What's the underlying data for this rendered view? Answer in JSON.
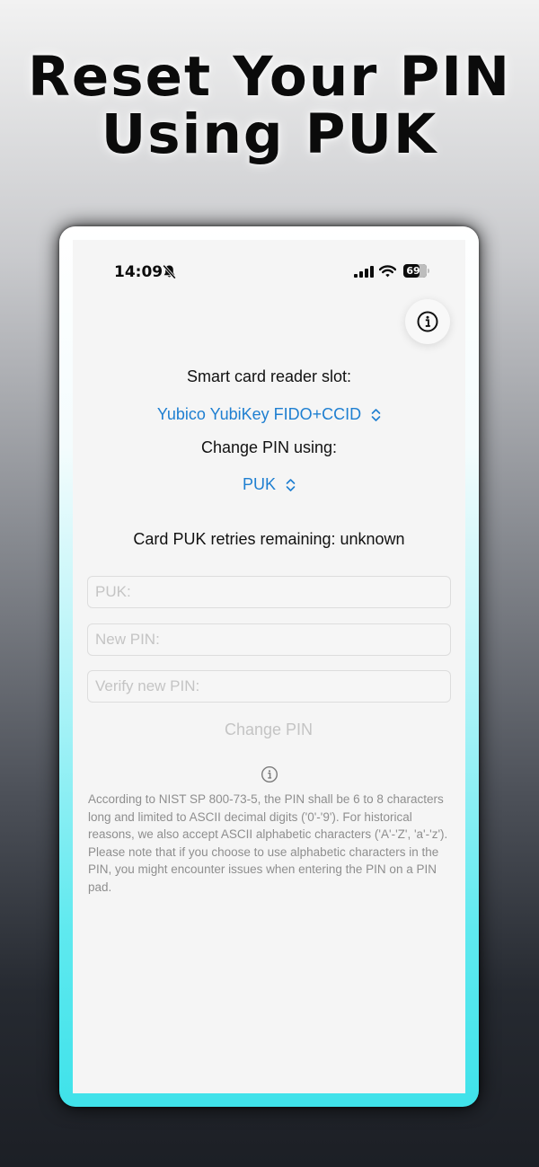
{
  "headline": {
    "line1": "Reset Your PIN",
    "line2": "Using PUK"
  },
  "status_bar": {
    "time": "14:09",
    "battery": "69",
    "icons": [
      "bell-slash-icon",
      "cellular-signal-icon",
      "wifi-icon",
      "battery-icon"
    ]
  },
  "info_button": {
    "icon": "info-circle-icon"
  },
  "reader": {
    "label": "Smart card reader slot:",
    "selected": "Yubico YubiKey FIDO+CCID"
  },
  "method": {
    "label": "Change PIN using:",
    "selected": "PUK"
  },
  "retries": "Card PUK retries remaining: unknown",
  "form": {
    "puk_placeholder": "PUK:",
    "new_pin_placeholder": "New PIN:",
    "verify_pin_placeholder": "Verify new PIN:",
    "submit_label": "Change PIN"
  },
  "note": {
    "icon": "info-circle-icon",
    "line1": "According to NIST SP 800-73-5, the PIN shall be 6 to 8 characters long and limited to ASCII decimal digits ('0'-'9'). For historical reasons, we also accept ASCII alphabetic characters ('A'-'Z', 'a'-'z').",
    "line2": "Please note that if you choose to use alphabetic characters in the PIN, you might encounter issues when entering the PIN on a PIN pad."
  },
  "colors": {
    "accent": "#1e7fd1",
    "disabled": "#c4c4c4",
    "frame_glow": "#3fe2ea"
  }
}
